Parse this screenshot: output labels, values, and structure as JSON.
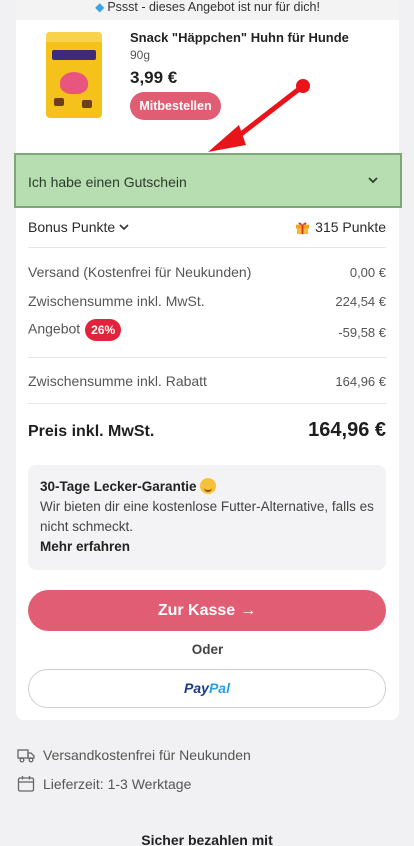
{
  "promo": {
    "banner_icon": "gem-icon",
    "banner_text": "Pssst - dieses Angebot ist nur für dich!"
  },
  "product": {
    "title": "Snack \"Häppchen\" Huhn für Hunde",
    "weight": "90g",
    "price": "3,99 €",
    "add_button": "Mitbestellen"
  },
  "voucher": {
    "label": "Ich habe einen Gutschein"
  },
  "bonus": {
    "label": "Bonus Punkte",
    "points": "315 Punkte"
  },
  "summary": {
    "shipping_label": "Versand (Kostenfrei für Neukunden)",
    "shipping_value": "0,00 €",
    "subtotal_label": "Zwischensumme inkl. MwSt.",
    "subtotal_value": "224,54 €",
    "offer_label": "Angebot",
    "offer_badge": "26%",
    "offer_value": "-59,58 €",
    "subtotal_discount_label": "Zwischensumme inkl. Rabatt",
    "subtotal_discount_value": "164,96 €",
    "total_label": "Preis inkl. MwSt.",
    "total_value": "164,96 €"
  },
  "guarantee": {
    "title": "30-Tage Lecker-Garantie",
    "text": "Wir bieten dir eine kostenlose Futter-Alternative, falls es nicht schmeckt.",
    "link": "Mehr erfahren"
  },
  "checkout": {
    "button": "Zur Kasse",
    "or": "Oder",
    "paypal_pay": "Pay",
    "paypal_pal": "Pal"
  },
  "info": {
    "shipping_free": "Versandkostenfrei für Neukunden",
    "delivery_time": "Lieferzeit: 1-3 Werktage"
  },
  "secure": {
    "title": "Sicher bezahlen mit"
  },
  "colors": {
    "accent": "#e05d74",
    "voucher_highlight": "#b7deb0",
    "discount_badge": "#e2233b",
    "annotation_arrow": "#e8141a"
  }
}
